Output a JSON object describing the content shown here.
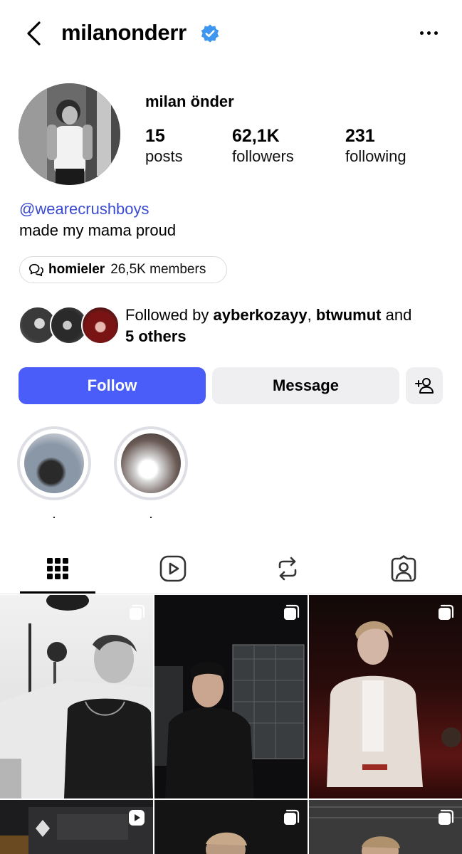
{
  "header": {
    "username": "milanonderr",
    "verified": true
  },
  "profile": {
    "display_name": "milan önder",
    "stats": [
      {
        "value": "15",
        "label": "posts"
      },
      {
        "value": "62,1K",
        "label": "followers"
      },
      {
        "value": "231",
        "label": "following"
      }
    ],
    "bio_link": "@wearecrushboys",
    "bio_text": "made my mama proud"
  },
  "channel": {
    "icon": "broadcast-channel-icon",
    "name": "homieler",
    "members": "26,5K members"
  },
  "followed_by": {
    "prefix": "Followed by ",
    "user1": "ayberkozayy",
    "sep": ", ",
    "user2": "btwumut",
    "and": " and",
    "others": "5 others"
  },
  "actions": {
    "follow_label": "Follow",
    "message_label": "Message",
    "add_icon": "add-person-icon"
  },
  "highlights": [
    {
      "label": "."
    },
    {
      "label": "."
    }
  ],
  "tabs": [
    "grid-icon",
    "reels-icon",
    "reposts-icon",
    "tagged-icon"
  ],
  "colors": {
    "accent": "#4a5df9",
    "link": "#3b4bd0",
    "verified": "#3d97f0",
    "button_gray": "#efeff2"
  }
}
